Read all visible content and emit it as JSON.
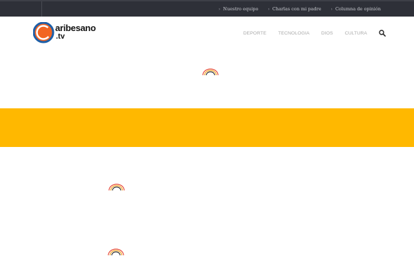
{
  "topbar": {
    "links": [
      {
        "label": "Nuestro equipo"
      },
      {
        "label": "Charlas con mi padre"
      },
      {
        "label": "Columna de opinión"
      }
    ]
  },
  "logo": {
    "text": "aribesano",
    "sub": ".tv",
    "letter": "c"
  },
  "nav": {
    "items": [
      {
        "label": "DEPORTE"
      },
      {
        "label": "TECNOLOGIA"
      },
      {
        "label": "DIOS"
      },
      {
        "label": "CULTURA"
      }
    ],
    "search_icon": "search-icon"
  },
  "colors": {
    "topbar_bg": "#2e3038",
    "banner": "#ffb800",
    "logo_orange": "#f26522",
    "logo_blue": "#1d5fa8"
  }
}
